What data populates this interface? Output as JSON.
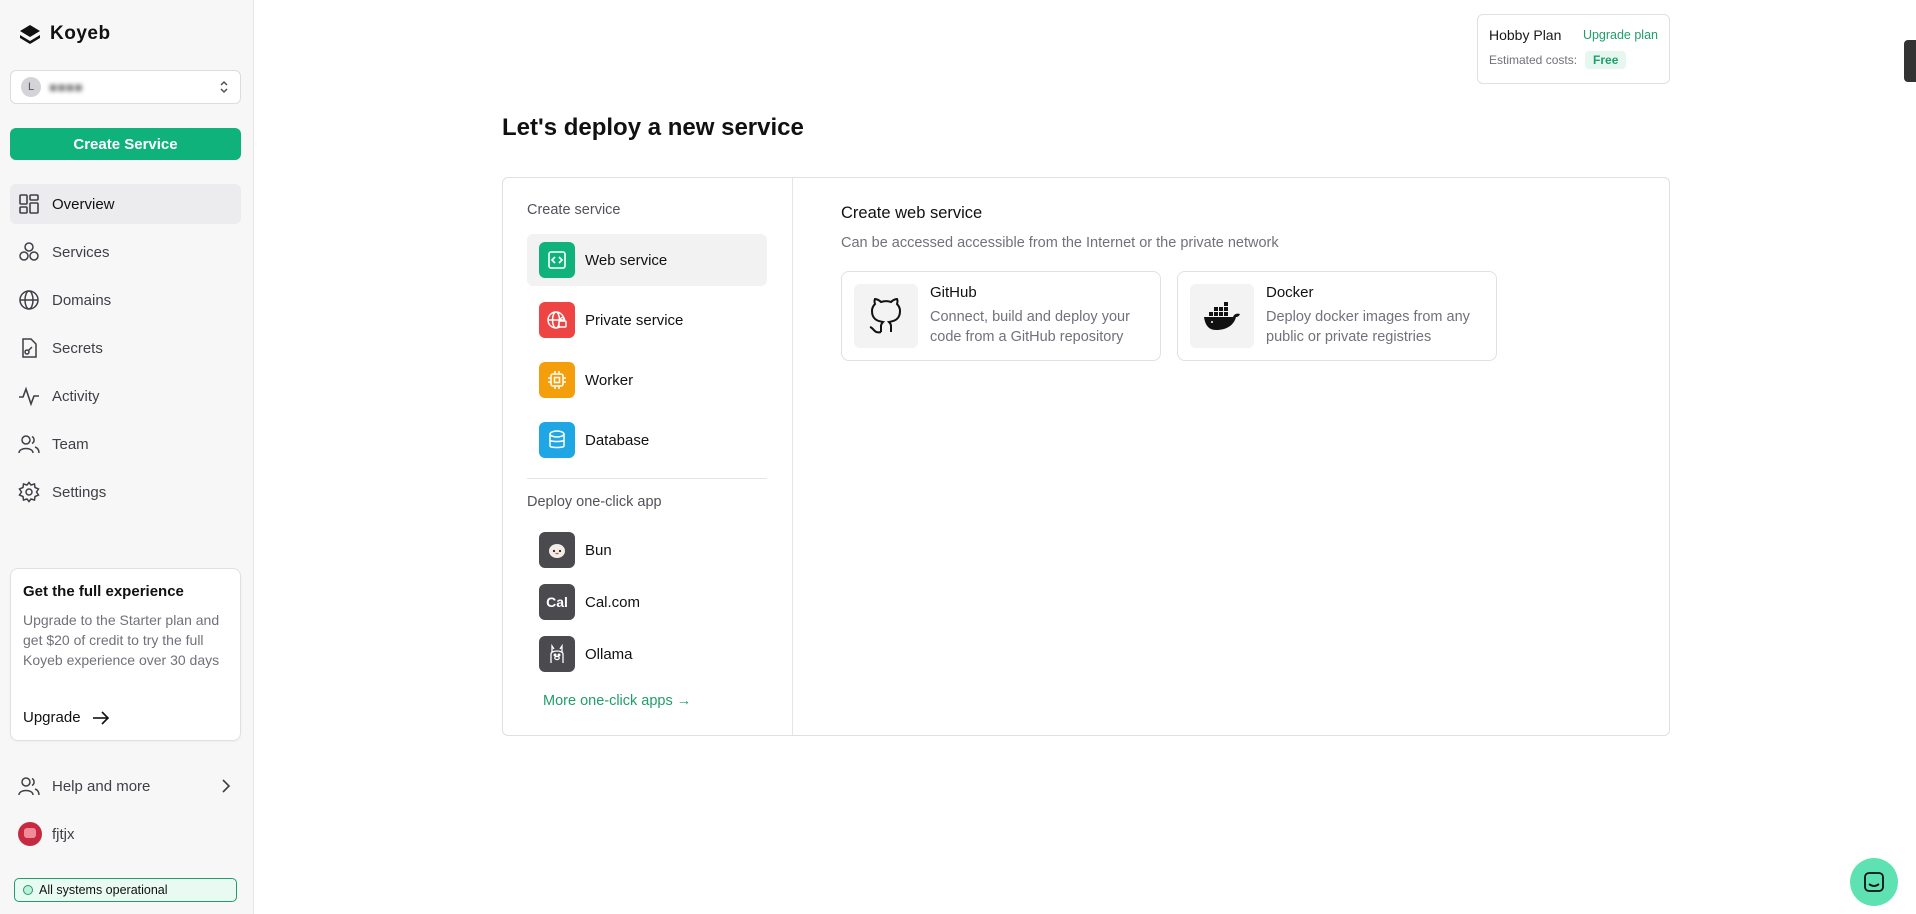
{
  "sidebar": {
    "brand": "Koyeb",
    "org": {
      "initial": "L",
      "name": "■■■■"
    },
    "create_label": "Create Service",
    "nav": [
      {
        "label": "Overview",
        "icon": "grid-icon"
      },
      {
        "label": "Services",
        "icon": "cubes-icon"
      },
      {
        "label": "Domains",
        "icon": "globe-icon"
      },
      {
        "label": "Secrets",
        "icon": "file-key-icon"
      },
      {
        "label": "Activity",
        "icon": "pulse-icon"
      },
      {
        "label": "Team",
        "icon": "users-icon"
      },
      {
        "label": "Settings",
        "icon": "gear-icon"
      }
    ],
    "promo": {
      "title": "Get the full experience",
      "text": "Upgrade to the Starter plan and get $20 of credit to try the full Koyeb experience over 30 days",
      "link": "Upgrade"
    },
    "help": "Help and more",
    "user": "fjtjx",
    "status": "All systems operational"
  },
  "plan": {
    "name": "Hobby Plan",
    "upgrade": "Upgrade plan",
    "estimated": "Estimated costs:",
    "badge": "Free"
  },
  "page_title": "Let's deploy a new service",
  "create": {
    "section_label": "Create service",
    "options": [
      {
        "label": "Web service",
        "color": "#10b27c"
      },
      {
        "label": "Private service",
        "color": "#ef4444"
      },
      {
        "label": "Worker",
        "color": "#f59e0b"
      },
      {
        "label": "Database",
        "color": "#1ea7e4"
      }
    ]
  },
  "oneclick": {
    "section_label": "Deploy one-click app",
    "apps": [
      {
        "label": "Bun"
      },
      {
        "label": "Cal.com",
        "glyph": "Cal"
      },
      {
        "label": "Ollama"
      }
    ],
    "more": "More one-click apps →"
  },
  "web_service": {
    "title": "Create web service",
    "subtitle": "Can be accessed accessible from the Internet or the private network",
    "sources": [
      {
        "title": "GitHub",
        "desc": "Connect, build and deploy your code from a GitHub repository"
      },
      {
        "title": "Docker",
        "desc": "Deploy docker images from any public or private registries"
      }
    ]
  }
}
